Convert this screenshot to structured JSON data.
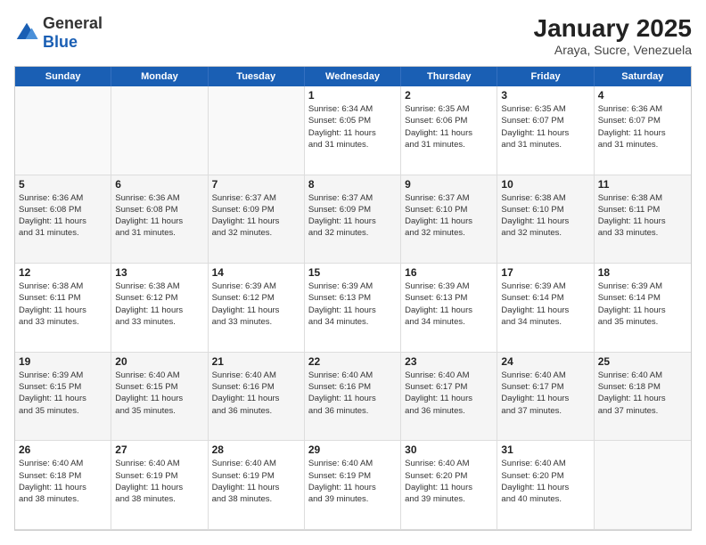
{
  "logo": {
    "general": "General",
    "blue": "Blue"
  },
  "title": "January 2025",
  "subtitle": "Araya, Sucre, Venezuela",
  "weekdays": [
    "Sunday",
    "Monday",
    "Tuesday",
    "Wednesday",
    "Thursday",
    "Friday",
    "Saturday"
  ],
  "weeks": [
    [
      {
        "day": "",
        "info": ""
      },
      {
        "day": "",
        "info": ""
      },
      {
        "day": "",
        "info": ""
      },
      {
        "day": "1",
        "info": "Sunrise: 6:34 AM\nSunset: 6:05 PM\nDaylight: 11 hours\nand 31 minutes."
      },
      {
        "day": "2",
        "info": "Sunrise: 6:35 AM\nSunset: 6:06 PM\nDaylight: 11 hours\nand 31 minutes."
      },
      {
        "day": "3",
        "info": "Sunrise: 6:35 AM\nSunset: 6:07 PM\nDaylight: 11 hours\nand 31 minutes."
      },
      {
        "day": "4",
        "info": "Sunrise: 6:36 AM\nSunset: 6:07 PM\nDaylight: 11 hours\nand 31 minutes."
      }
    ],
    [
      {
        "day": "5",
        "info": "Sunrise: 6:36 AM\nSunset: 6:08 PM\nDaylight: 11 hours\nand 31 minutes."
      },
      {
        "day": "6",
        "info": "Sunrise: 6:36 AM\nSunset: 6:08 PM\nDaylight: 11 hours\nand 31 minutes."
      },
      {
        "day": "7",
        "info": "Sunrise: 6:37 AM\nSunset: 6:09 PM\nDaylight: 11 hours\nand 32 minutes."
      },
      {
        "day": "8",
        "info": "Sunrise: 6:37 AM\nSunset: 6:09 PM\nDaylight: 11 hours\nand 32 minutes."
      },
      {
        "day": "9",
        "info": "Sunrise: 6:37 AM\nSunset: 6:10 PM\nDaylight: 11 hours\nand 32 minutes."
      },
      {
        "day": "10",
        "info": "Sunrise: 6:38 AM\nSunset: 6:10 PM\nDaylight: 11 hours\nand 32 minutes."
      },
      {
        "day": "11",
        "info": "Sunrise: 6:38 AM\nSunset: 6:11 PM\nDaylight: 11 hours\nand 33 minutes."
      }
    ],
    [
      {
        "day": "12",
        "info": "Sunrise: 6:38 AM\nSunset: 6:11 PM\nDaylight: 11 hours\nand 33 minutes."
      },
      {
        "day": "13",
        "info": "Sunrise: 6:38 AM\nSunset: 6:12 PM\nDaylight: 11 hours\nand 33 minutes."
      },
      {
        "day": "14",
        "info": "Sunrise: 6:39 AM\nSunset: 6:12 PM\nDaylight: 11 hours\nand 33 minutes."
      },
      {
        "day": "15",
        "info": "Sunrise: 6:39 AM\nSunset: 6:13 PM\nDaylight: 11 hours\nand 34 minutes."
      },
      {
        "day": "16",
        "info": "Sunrise: 6:39 AM\nSunset: 6:13 PM\nDaylight: 11 hours\nand 34 minutes."
      },
      {
        "day": "17",
        "info": "Sunrise: 6:39 AM\nSunset: 6:14 PM\nDaylight: 11 hours\nand 34 minutes."
      },
      {
        "day": "18",
        "info": "Sunrise: 6:39 AM\nSunset: 6:14 PM\nDaylight: 11 hours\nand 35 minutes."
      }
    ],
    [
      {
        "day": "19",
        "info": "Sunrise: 6:39 AM\nSunset: 6:15 PM\nDaylight: 11 hours\nand 35 minutes."
      },
      {
        "day": "20",
        "info": "Sunrise: 6:40 AM\nSunset: 6:15 PM\nDaylight: 11 hours\nand 35 minutes."
      },
      {
        "day": "21",
        "info": "Sunrise: 6:40 AM\nSunset: 6:16 PM\nDaylight: 11 hours\nand 36 minutes."
      },
      {
        "day": "22",
        "info": "Sunrise: 6:40 AM\nSunset: 6:16 PM\nDaylight: 11 hours\nand 36 minutes."
      },
      {
        "day": "23",
        "info": "Sunrise: 6:40 AM\nSunset: 6:17 PM\nDaylight: 11 hours\nand 36 minutes."
      },
      {
        "day": "24",
        "info": "Sunrise: 6:40 AM\nSunset: 6:17 PM\nDaylight: 11 hours\nand 37 minutes."
      },
      {
        "day": "25",
        "info": "Sunrise: 6:40 AM\nSunset: 6:18 PM\nDaylight: 11 hours\nand 37 minutes."
      }
    ],
    [
      {
        "day": "26",
        "info": "Sunrise: 6:40 AM\nSunset: 6:18 PM\nDaylight: 11 hours\nand 38 minutes."
      },
      {
        "day": "27",
        "info": "Sunrise: 6:40 AM\nSunset: 6:19 PM\nDaylight: 11 hours\nand 38 minutes."
      },
      {
        "day": "28",
        "info": "Sunrise: 6:40 AM\nSunset: 6:19 PM\nDaylight: 11 hours\nand 38 minutes."
      },
      {
        "day": "29",
        "info": "Sunrise: 6:40 AM\nSunset: 6:19 PM\nDaylight: 11 hours\nand 39 minutes."
      },
      {
        "day": "30",
        "info": "Sunrise: 6:40 AM\nSunset: 6:20 PM\nDaylight: 11 hours\nand 39 minutes."
      },
      {
        "day": "31",
        "info": "Sunrise: 6:40 AM\nSunset: 6:20 PM\nDaylight: 11 hours\nand 40 minutes."
      },
      {
        "day": "",
        "info": ""
      }
    ]
  ]
}
